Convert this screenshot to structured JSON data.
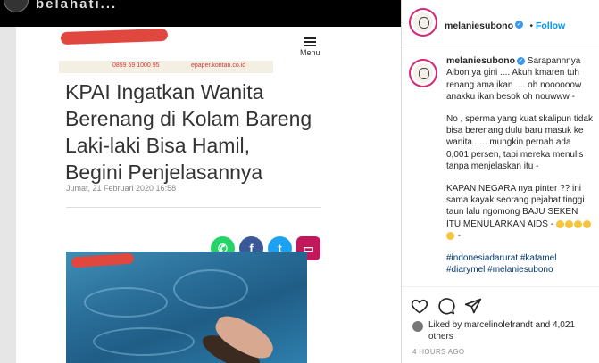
{
  "topbar": {
    "caption": "belahati..."
  },
  "article": {
    "menu_label": "Menu",
    "phone": "0859 59 1000 95",
    "site": "epaper.kontan.co.id",
    "headline": "KPAI Ingatkan Wanita\nBerenang di Kolam Bareng\nLaki-laki Bisa Hamil,\nBegini Penjelasannya",
    "date": "Jumat, 21 Februari 2020 16:58",
    "share": [
      {
        "name": "whatsapp",
        "label": "✆",
        "color": "#25d366"
      },
      {
        "name": "facebook",
        "label": "f",
        "color": "#3b5998"
      },
      {
        "name": "twitter",
        "label": "t",
        "color": "#1da1f2"
      },
      {
        "name": "comment",
        "label": "▭",
        "color": "#c2185b"
      }
    ]
  },
  "post": {
    "header": {
      "username": "melaniesubono",
      "follow": "Follow"
    },
    "caption": {
      "username": "melaniesubono",
      "p1": "Sarapannnya Albon ya gini .... Akuh kmaren tuh renang ama ikan .... oh noooooow anakku ikan besok oh nouwww -",
      "p2": "No , sperma yang kuat skalipun tidak bisa berenang dulu baru masuk ke wanita ..... mungkin pernah ada 0,001 persen, tapi mereka menulis tanpa menjelaskan itu -",
      "p3": "KAPAN NEGARA nya pinter ?? ini sama kayak seorang pejabat tinggi taun lalu ngomong BAJU SEKEN ITU MENULARKAN AIDS -",
      "p3_tail": "-",
      "hashtags": "#indonesiadarurat #katamel #diarymel #melaniesubono"
    },
    "likes": "Liked by marcelinolefrandt and 4,021 others",
    "time": "4 HOURS AGO"
  },
  "colors": {
    "verified": "#3897f0",
    "follow": "#0095f6",
    "hashtag": "#00376b",
    "redaction": "#e0473f"
  }
}
